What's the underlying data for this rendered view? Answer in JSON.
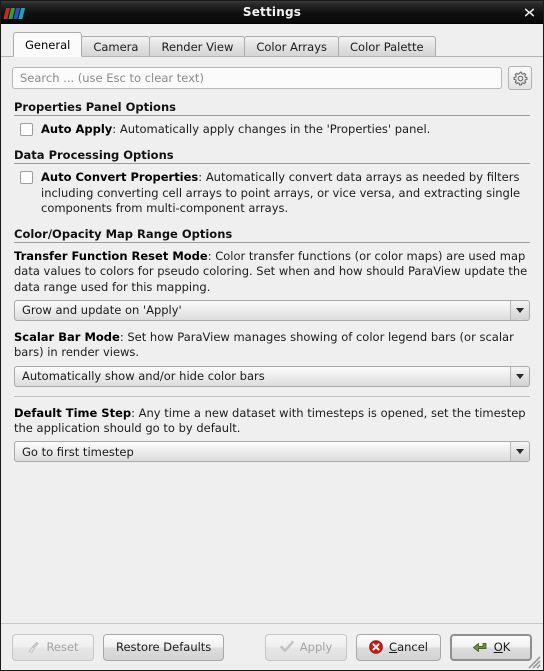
{
  "window": {
    "title": "Settings",
    "logo_icon": "paraview-logo-icon",
    "close_icon": "close-icon",
    "resize_grip_icon": "resize-grip-icon"
  },
  "tabs": [
    {
      "label": "General",
      "active": true
    },
    {
      "label": "Camera",
      "active": false
    },
    {
      "label": "Render View",
      "active": false
    },
    {
      "label": "Color Arrays",
      "active": false
    },
    {
      "label": "Color Palette",
      "active": false
    }
  ],
  "search": {
    "value": "",
    "placeholder": "Search ... (use Esc to clear text)",
    "gear_icon": "gear-icon"
  },
  "sections": {
    "properties_panel": {
      "title": "Properties Panel Options",
      "auto_apply": {
        "name": "Auto Apply",
        "separator": ": ",
        "description": "Automatically apply changes in the 'Properties' panel.",
        "checked": false
      }
    },
    "data_processing": {
      "title": "Data Processing Options",
      "auto_convert": {
        "name": "Auto Convert Properties",
        "separator": ": ",
        "description": "Automatically convert data arrays as needed by filters including converting cell arrays to point arrays, or vice versa, and extracting single components from multi-component arrays.",
        "checked": false
      }
    },
    "color_opacity": {
      "title": "Color/Opacity Map Range Options",
      "transfer_function": {
        "name": "Transfer Function Reset Mode",
        "separator": ": ",
        "description": "Color transfer functions (or color maps) are used map data values to colors for pseudo coloring. Set when and how should ParaView update the data range used for this mapping.",
        "selected": "Grow and update on 'Apply'"
      },
      "scalar_bar": {
        "name": "Scalar Bar Mode",
        "separator": ": ",
        "description": "Set how ParaView manages showing of color legend bars (or scalar bars) in render views.",
        "selected": "Automatically show and/or hide color bars"
      },
      "default_time_step": {
        "name": "Default Time Step",
        "separator": ": ",
        "description": "Any time a new dataset with timesteps is opened, set the timestep the application should go to by default.",
        "selected": "Go to first timestep"
      }
    }
  },
  "footer": {
    "reset": {
      "label": "Reset",
      "icon": "broom-icon",
      "enabled": false
    },
    "restore_defaults": {
      "label": "Restore Defaults",
      "enabled": true
    },
    "apply": {
      "label": "Apply",
      "icon": "check-icon",
      "enabled": false
    },
    "cancel": {
      "label": "Cancel",
      "mnemonic": "C",
      "rest": "ancel",
      "icon": "cancel-circle-icon",
      "enabled": true
    },
    "ok": {
      "label": "OK",
      "mnemonic": "O",
      "rest": "K",
      "icon": "enter-arrow-icon",
      "enabled": true,
      "is_default": true
    }
  },
  "colors": {
    "titlebar": "#121212",
    "dialog_bg": "#efefef",
    "accent_red": "#d21a13",
    "accent_green": "#6f8f3a",
    "logo_red": "#c62a22",
    "logo_green": "#2f9e35",
    "logo_blue": "#2a4fc4",
    "logo_cyan": "#1aa6b8"
  }
}
